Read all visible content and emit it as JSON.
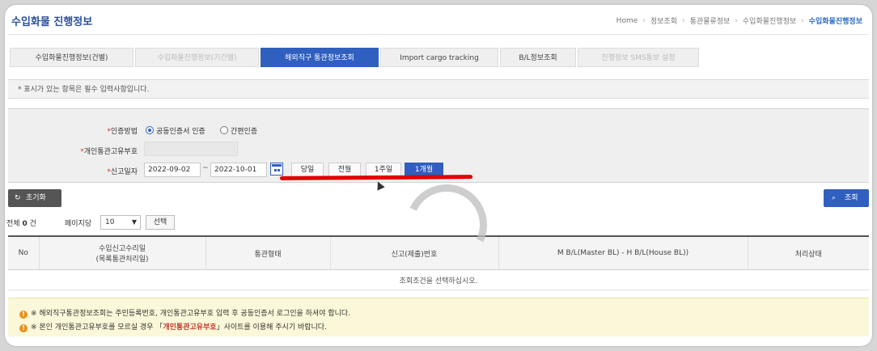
{
  "header": {
    "title": "수입화물 진행정보",
    "breadcrumb": [
      "Home",
      "정보조회",
      "통관물류정보",
      "수입화물진행정보",
      "수입화물진행정보"
    ]
  },
  "tabs": [
    {
      "label": "수입화물진행정보(건별)",
      "state": "normal"
    },
    {
      "label": "수입화물진행정보(기간별)",
      "state": "dim"
    },
    {
      "label": "해외직구 통관정보조회",
      "state": "active"
    },
    {
      "label": "Import cargo tracking",
      "state": "normal"
    },
    {
      "label": "B/L정보조회",
      "state": "normal"
    },
    {
      "label": "진행정보 SMS통보 설정",
      "state": "dim"
    }
  ],
  "notice": "* 표시가 있는 항목은 필수 입력사항입니다.",
  "form": {
    "auth_label": "인증방법",
    "auth_options": [
      "공동인증서 인증",
      "간편인증"
    ],
    "auth_selected": 0,
    "pccc_label": "개인통관고유부호",
    "pccc_value": "",
    "date_label": "신고일자",
    "date_from": "2022-09-02",
    "date_sep": "~",
    "date_to": "2022-10-01",
    "period_buttons": [
      "당일",
      "전월",
      "1주일",
      "1개월"
    ],
    "period_selected": 3
  },
  "actions": {
    "reset_label": "초기화",
    "search_label": "조회"
  },
  "list": {
    "total_prefix": "전체",
    "total_count": "0",
    "total_suffix": "건",
    "per_page_label": "페이지당",
    "per_page_value": "10",
    "choose_label": "선택",
    "columns": [
      "No",
      "수입신고수리일\n(목록통관처리일)",
      "통관형태",
      "신고(제출)번호",
      "M B/L(Master BL) - H B/L(House BL))",
      "처리상태"
    ],
    "empty_message": "조회조건을 선택하십시오."
  },
  "alerts": [
    {
      "prefix": "※ 해외직구통관정보조회는 주민등록번호, 개인통관고유부호 입력 후 공동인증서 로그인을 하셔야 합니다.",
      "link": "",
      "suffix": ""
    },
    {
      "prefix": "※ 본인 개인통관고유부호를 모르실 경우 「",
      "link": "개인통관고유부호",
      "suffix": "」사이트를 이용해 주시기 바랍니다."
    }
  ],
  "colors": {
    "accent": "#2f5fbf",
    "annotation": "#e10000",
    "alert_bg": "#fbf7d9"
  },
  "icons": [
    "refresh-icon",
    "search-icon",
    "calendar-icon",
    "warning-icon",
    "loading-spinner-icon"
  ]
}
